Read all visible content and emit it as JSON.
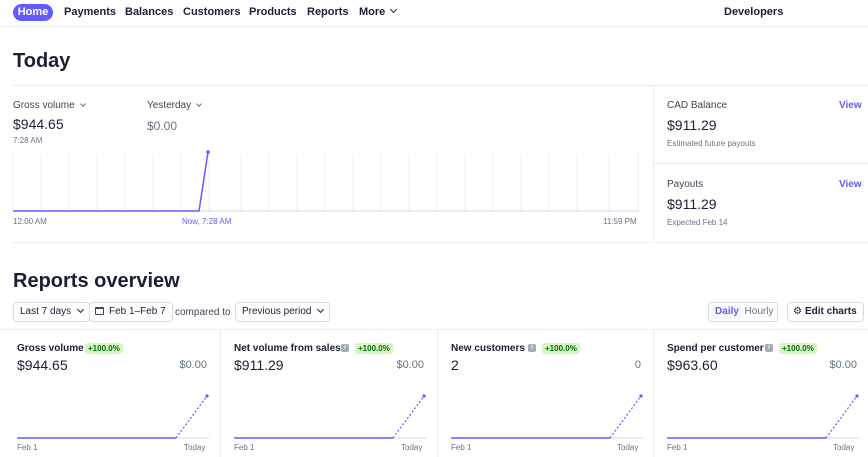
{
  "nav": {
    "items": [
      "Home",
      "Payments",
      "Balances",
      "Customers",
      "Products",
      "Reports",
      "More"
    ],
    "right": "Developers"
  },
  "today": {
    "title": "Today",
    "gross_label": "Gross volume",
    "gross_value": "$944.65",
    "gross_time": "7:28 AM",
    "compare_label": "Yesterday",
    "compare_value": "$0.00",
    "axis_start": "12:00 AM",
    "axis_now": "Now, 7:28 AM",
    "axis_end": "11:59 PM"
  },
  "side": {
    "balance_label": "CAD Balance",
    "balance_link": "View",
    "balance_value": "$911.29",
    "balance_note": "Estimated future payouts",
    "payouts_label": "Payouts",
    "payouts_link": "View",
    "payouts_value": "$911.29",
    "payouts_note": "Expected Feb 14"
  },
  "reports": {
    "title": "Reports overview",
    "range": "Last 7 days",
    "dates": "Feb 1–Feb 7",
    "compared_to": "compared to",
    "period": "Previous period",
    "daily": "Daily",
    "hourly": "Hourly",
    "edit": "Edit charts",
    "cards": [
      {
        "title": "Gross volume",
        "badge": "+100.0%",
        "value": "$944.65",
        "prev": "$0.00",
        "from": "Feb 1",
        "to": "Today"
      },
      {
        "title": "Net volume from sales",
        "badge": "+100.0%",
        "value": "$911.29",
        "prev": "$0.00",
        "from": "Feb 1",
        "to": "Today"
      },
      {
        "title": "New customers",
        "badge": "+100.0%",
        "value": "2",
        "prev": "0",
        "from": "Feb 1",
        "to": "Today"
      },
      {
        "title": "Spend per customer",
        "badge": "+100.0%",
        "value": "$963.60",
        "prev": "$0.00",
        "from": "Feb 1",
        "to": "Today"
      }
    ]
  },
  "colors": {
    "accent": "#635bff",
    "badge_bg": "#d7f7c2",
    "badge_text": "#05690d"
  }
}
